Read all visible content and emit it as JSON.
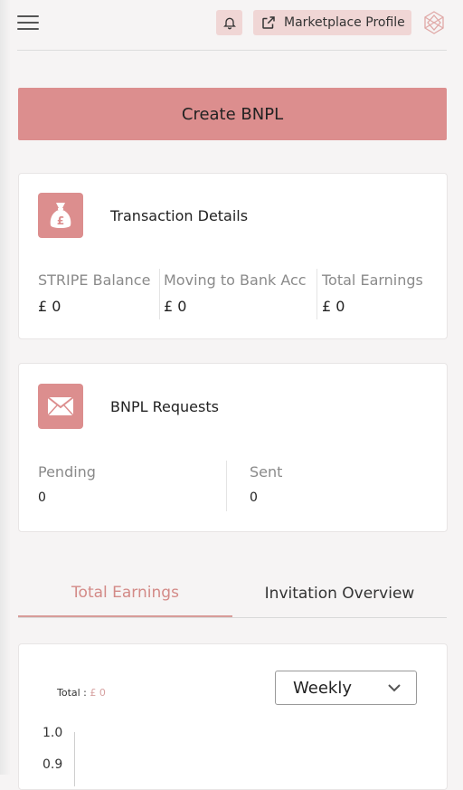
{
  "header": {
    "marketplace_profile_label": "Marketplace Profile"
  },
  "create_button_label": "Create BNPL",
  "transactions": {
    "title": "Transaction Details",
    "stats": [
      {
        "label": "STRIPE Balance",
        "value": "£ 0"
      },
      {
        "label": "Moving to Bank Acc",
        "value": "£ 0"
      },
      {
        "label": "Total Earnings",
        "value": "£ 0"
      }
    ]
  },
  "bnpl_requests": {
    "title": "BNPL Requests",
    "stats": [
      {
        "label": "Pending",
        "value": "0"
      },
      {
        "label": "Sent",
        "value": "0"
      }
    ]
  },
  "tabs": [
    {
      "label": "Total Earnings",
      "active": true
    },
    {
      "label": "Invitation Overview",
      "active": false
    }
  ],
  "chart": {
    "total_label": "Total :",
    "total_value": "£ 0",
    "period_select": "Weekly"
  },
  "chart_data": {
    "type": "line",
    "yticks": [
      "1.0",
      "0.9"
    ],
    "series": []
  },
  "colors": {
    "accent": "#dc8e8e",
    "accent_light": "#f0d6d5",
    "tab_active": "#d38a87"
  }
}
